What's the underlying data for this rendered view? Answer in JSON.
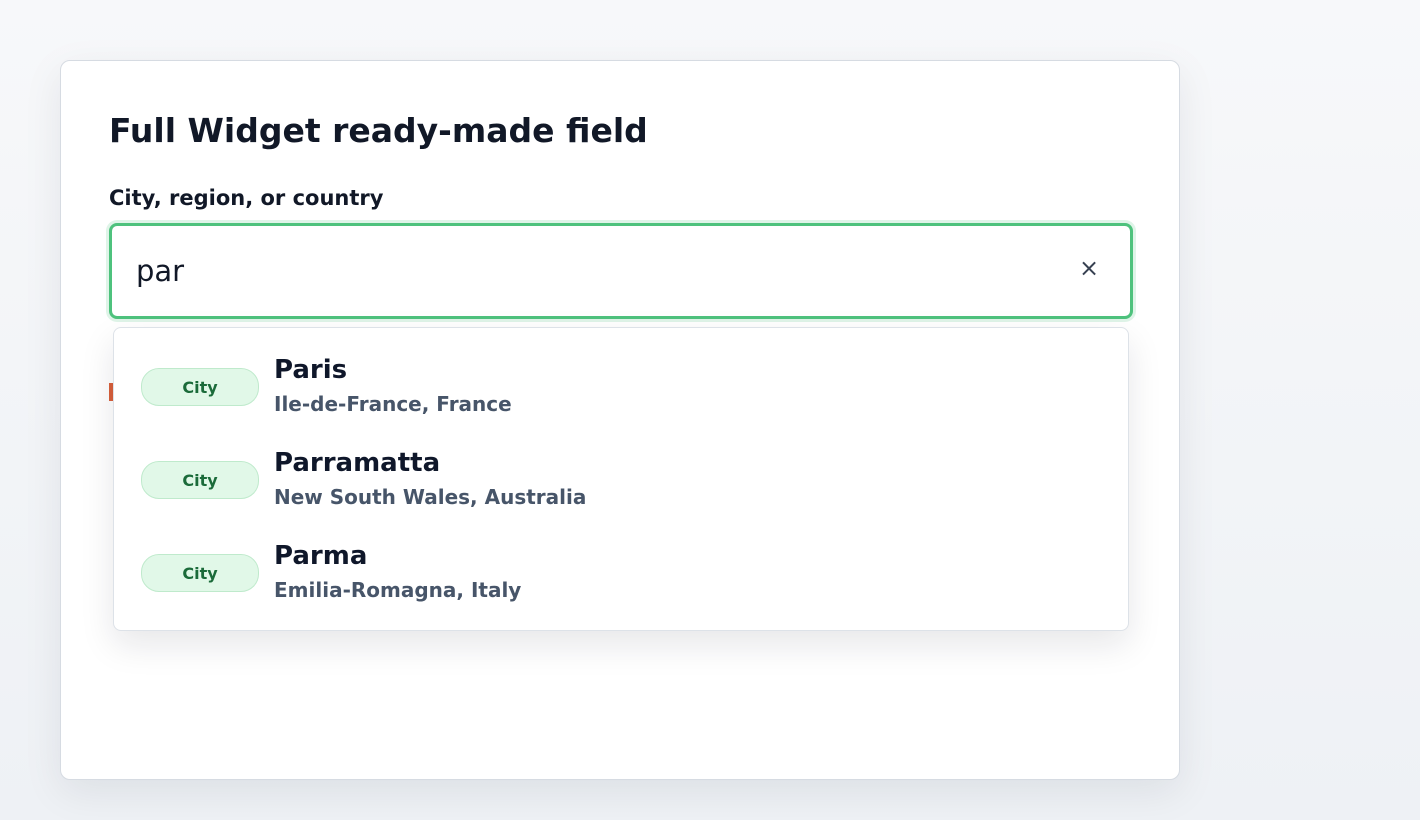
{
  "card": {
    "title": "Full Widget ready-made field",
    "field_label": "City, region, or country"
  },
  "search": {
    "value": "par",
    "clear_label": "×"
  },
  "colors": {
    "focus_border": "#4ec27d",
    "badge_background": "#e1f8e8",
    "badge_text": "#1b6b3a",
    "error_accent": "#d9603b"
  },
  "suggestions": [
    {
      "badge": "City",
      "name": "Paris",
      "region": "Ile-de-France, France"
    },
    {
      "badge": "City",
      "name": "Parramatta",
      "region": "New South Wales, Australia"
    },
    {
      "badge": "City",
      "name": "Parma",
      "region": "Emilia-Romagna, Italy"
    }
  ]
}
